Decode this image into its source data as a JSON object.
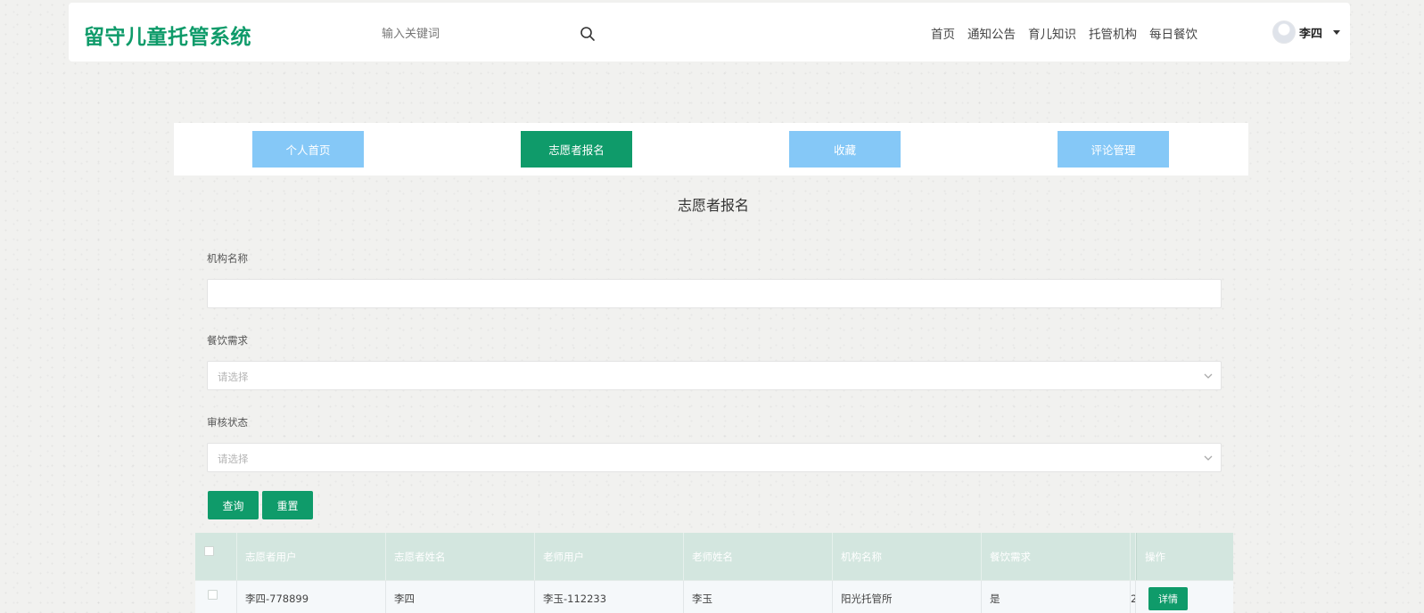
{
  "header": {
    "logo": "留守儿童托管系统",
    "search": {
      "placeholder": "输入关键词"
    },
    "nav": [
      "首页",
      "通知公告",
      "育儿知识",
      "托管机构",
      "每日餐饮"
    ],
    "user": {
      "name": "李四"
    }
  },
  "tabs": [
    {
      "label": "个人首页",
      "active": false
    },
    {
      "label": "志愿者报名",
      "active": true
    },
    {
      "label": "收藏",
      "active": false
    },
    {
      "label": "评论管理",
      "active": false
    }
  ],
  "page_title": "志愿者报名",
  "form": {
    "org_name": {
      "label": "机构名称",
      "value": ""
    },
    "meal_need": {
      "label": "餐饮需求",
      "placeholder": "请选择"
    },
    "review_status": {
      "label": "审核状态",
      "placeholder": "请选择"
    },
    "query_label": "查询",
    "reset_label": "重置"
  },
  "table": {
    "columns": [
      "志愿者用户",
      "志愿者姓名",
      "老师用户",
      "老师姓名",
      "机构名称",
      "餐饮需求",
      "",
      "操作"
    ],
    "rows": [
      {
        "cells": [
          "李四-778899",
          "李四",
          "李玉-112233",
          "李玉",
          "阳光托管所",
          "是",
          "2"
        ],
        "action": "详情"
      }
    ]
  },
  "colors": {
    "primary": "#0f9b6a",
    "tab": "#85c8f7",
    "table_header": "#d3e6df"
  }
}
